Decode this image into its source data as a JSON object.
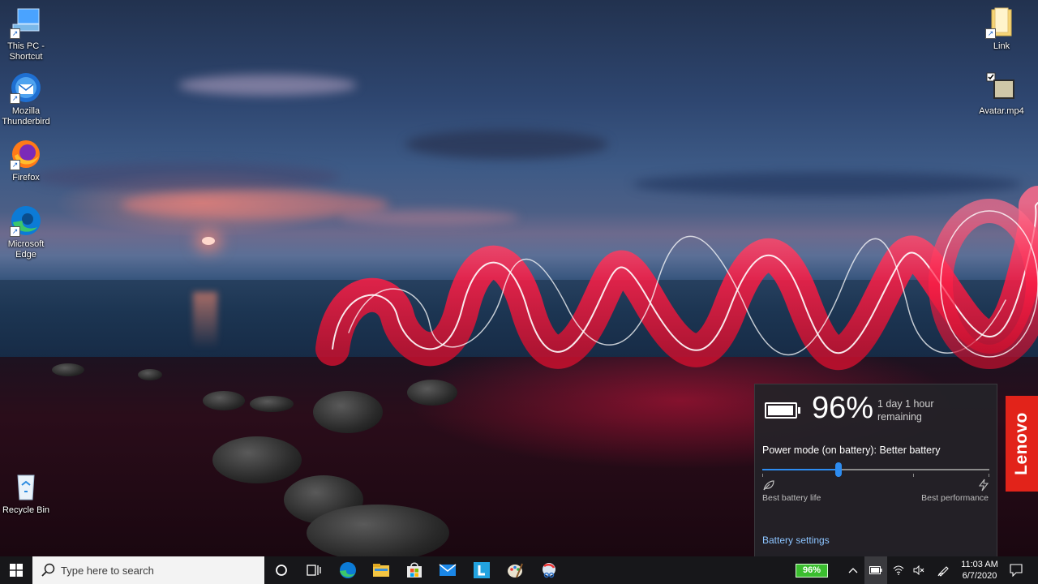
{
  "desktop": {
    "left_icons": [
      {
        "label_line1": "This PC -",
        "label_line2": "Shortcut",
        "icon": "this-pc-icon"
      },
      {
        "label_line1": "Mozilla",
        "label_line2": "Thunderbird",
        "icon": "thunderbird-icon"
      },
      {
        "label_line1": "Firefox",
        "label_line2": "",
        "icon": "firefox-icon"
      },
      {
        "label_line1": "Microsoft",
        "label_line2": "Edge",
        "icon": "edge-icon"
      },
      {
        "label_line1": "Recycle Bin",
        "label_line2": "",
        "icon": "recycle-bin-icon"
      }
    ],
    "right_icons": [
      {
        "label": "Link",
        "icon": "folder-icon"
      },
      {
        "label": "Avatar.mp4",
        "icon": "video-file-icon"
      }
    ]
  },
  "battery_flyout": {
    "percent": "96%",
    "remaining_line1": "1 day 1 hour",
    "remaining_line2": "remaining",
    "power_mode": "Power mode (on battery): Better battery",
    "slider_fraction": 0.335,
    "label_left": "Best battery life",
    "label_right": "Best performance",
    "settings_link": "Battery settings"
  },
  "brand": {
    "name": "Lenovo",
    "color": "#e2231a"
  },
  "taskbar": {
    "search_placeholder": "Type here to search",
    "pinned": [
      "cortana-icon",
      "task-view-icon",
      "edge-icon",
      "file-explorer-icon",
      "microsoft-store-icon",
      "mail-icon",
      "l-app-icon",
      "paint-icon",
      "snip-icon"
    ],
    "tray": {
      "battery_percent": "96%",
      "time": "11:03 AM",
      "date": "6/7/2020",
      "icons": [
        "chevron-up-icon",
        "battery-icon",
        "wifi-icon",
        "volume-muted-icon",
        "pen-icon",
        "notification-icon"
      ]
    }
  },
  "colors": {
    "accent": "#2d8cf0",
    "link": "#8cc4ff",
    "tray_battery": "#3bbd2f"
  }
}
